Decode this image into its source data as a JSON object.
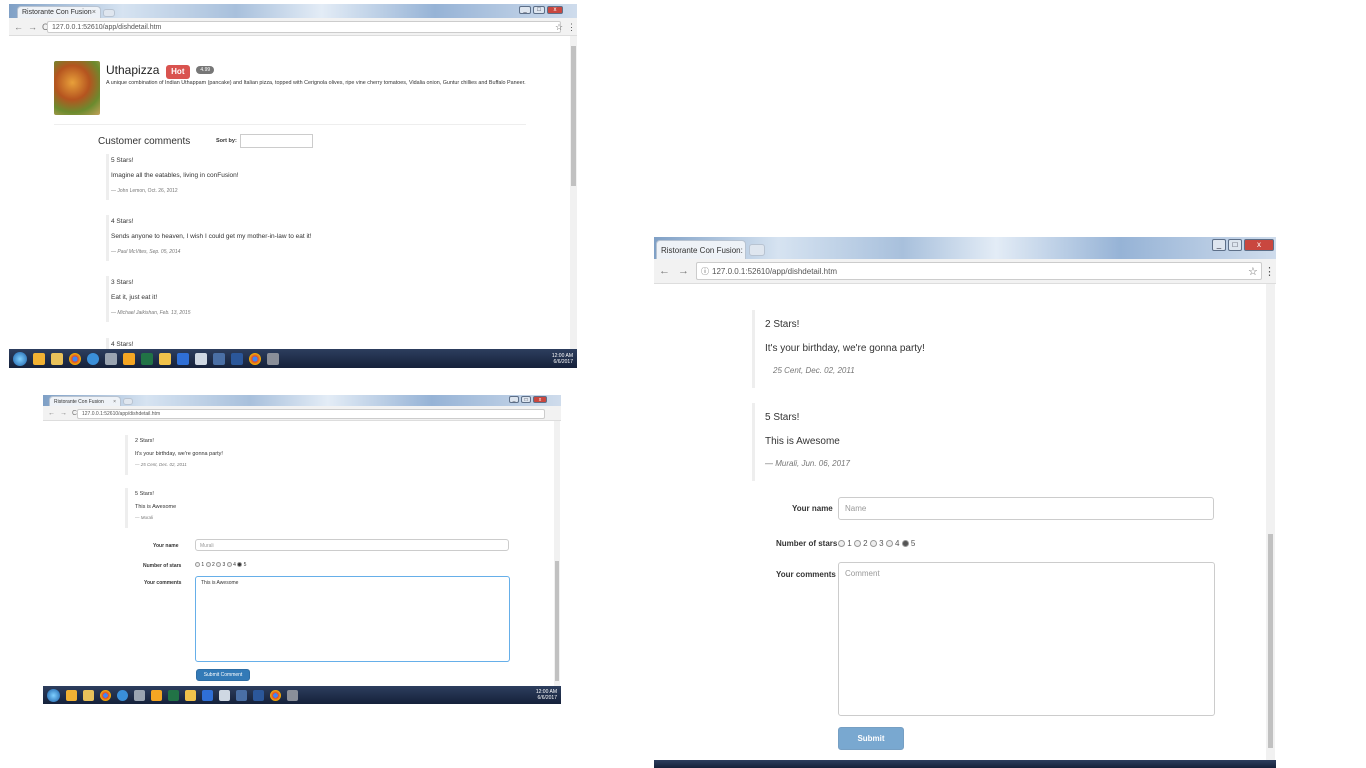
{
  "tab_title": "Ristorante Con Fusion",
  "tab_title_short": "Ristorante Con Fusion: M",
  "url_a": "127.0.0.1:52610/app/dishdetail.htm",
  "url_c": "127.0.0.1:52610/app/dishdetail.htm",
  "window_controls": {
    "minimize": "_",
    "maximize": "□",
    "close": "x"
  },
  "nav": {
    "back": "←",
    "forward": "→",
    "reload": "C",
    "info": "ⓘ"
  },
  "icons": {
    "bookmark": "☆",
    "menu": "⋮"
  },
  "dish": {
    "name": "Uthapizza",
    "label": "Hot",
    "price": "4.99",
    "description": "A unique combination of Indian Uthappam (pancake) and Italian pizza, topped with Cerignola olives, ripe vine cherry tomatoes, Vidalia onion, Guntur chillies and Buffalo Paneer."
  },
  "comments_heading": "Customer comments",
  "sort_label": "Sort by:",
  "comments_a": [
    {
      "rating": "5 Stars!",
      "text": "Imagine all the eatables, living in conFusion!",
      "author": "— John Lemon, Oct. 26, 2012"
    },
    {
      "rating": "4 Stars!",
      "text": "Sends anyone to heaven, I wish I could get my mother-in-law to eat it!",
      "author": "— Paul McVites, Sep. 05, 2014"
    },
    {
      "rating": "3 Stars!",
      "text": "Eat it, just eat it!",
      "author": "— Michael Jaikishan, Feb. 13, 2015"
    },
    {
      "rating": "4 Stars!",
      "text": "",
      "author": ""
    }
  ],
  "comments_b": [
    {
      "rating": "2 Stars!",
      "text": "It's your birthday, we're gonna party!",
      "author": "— 25 Cent, Dec. 02, 2011"
    },
    {
      "rating": "5 Stars!",
      "text": "This is Awesome",
      "author": "— Murali"
    }
  ],
  "comments_c": [
    {
      "rating": "2 Stars!",
      "text": "It's your birthday, we're gonna party!",
      "author": "25 Cent, Dec. 02, 2011"
    },
    {
      "rating": "5 Stars!",
      "text": "This is Awesome",
      "author": "— Murali, Jun. 06, 2017"
    }
  ],
  "form": {
    "name_label": "Your name",
    "name_placeholder": "Name",
    "name_value_b": "Murali",
    "stars_label": "Number of stars",
    "star_options": [
      "1",
      "2",
      "3",
      "4",
      "5"
    ],
    "comments_label": "Your comments",
    "comments_placeholder": "Comment",
    "comments_value_b": "This is Awesome",
    "submit_label": "Submit Comment"
  },
  "taskbar": {
    "time": "12:00 AM",
    "date": "6/6/2017"
  },
  "colors": {
    "primary": "#337ab7",
    "danger": "#d9534f",
    "badge": "#777777",
    "taskbar": "#1e2c48"
  }
}
